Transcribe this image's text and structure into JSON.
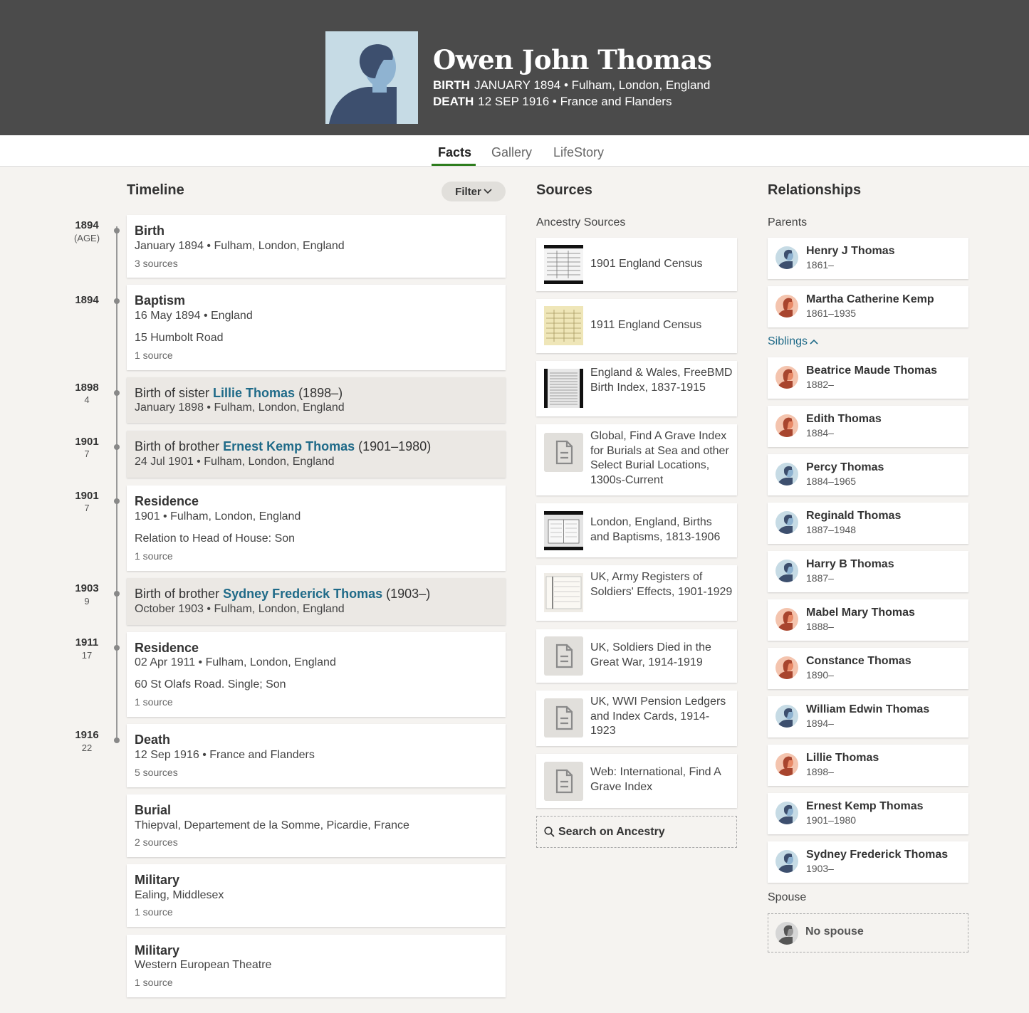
{
  "person": {
    "name": "Owen John Thomas",
    "birth_label": "BIRTH",
    "birth_value": "JANUARY 1894 • Fulham, London, England",
    "death_label": "DEATH",
    "death_value": "12 SEP 1916 • France and Flanders"
  },
  "tabs": [
    {
      "label": "Facts",
      "active": true
    },
    {
      "label": "Gallery",
      "active": false
    },
    {
      "label": "LifeStory",
      "active": false
    }
  ],
  "timeline": {
    "title": "Timeline",
    "filter_label": "Filter",
    "markers": [
      {
        "year": "1894",
        "age": "(AGE)"
      },
      {
        "year": "1894",
        "age": ""
      },
      {
        "year": "1898",
        "age": "4"
      },
      {
        "year": "1901",
        "age": "7"
      },
      {
        "year": "1901",
        "age": "7"
      },
      {
        "year": "1903",
        "age": "9"
      },
      {
        "year": "1911",
        "age": "17"
      },
      {
        "year": "1916",
        "age": "22"
      }
    ],
    "events": [
      {
        "title": "Birth",
        "line1": "January 1894 • Fulham, London, England",
        "sources": "3 sources"
      },
      {
        "title": "Baptism",
        "line1": "16 May 1894 • England",
        "line2": "15 Humbolt Road",
        "sources": "1 source"
      },
      {
        "prefix": "Birth of sister ",
        "link": "Lillie Thomas",
        "suffix": " (1898–)",
        "line1": "January 1898 • Fulham, London, England"
      },
      {
        "prefix": "Birth of brother ",
        "link": "Ernest Kemp Thomas",
        "suffix": " (1901–1980)",
        "line1": "24 Jul 1901 • Fulham, London, England"
      },
      {
        "title": "Residence",
        "line1": "1901 • Fulham, London, England",
        "line2": "Relation to Head of House: Son",
        "sources": "1 source"
      },
      {
        "prefix": "Birth of brother ",
        "link": "Sydney Frederick Thomas",
        "suffix": " (1903–)",
        "line1": "October 1903 • Fulham, London, England"
      },
      {
        "title": "Residence",
        "line1": "02 Apr 1911 • Fulham, London, England",
        "line2": "60 St Olafs Road. Single; Son",
        "sources": "1 source"
      },
      {
        "title": "Death",
        "line1": "12 Sep 1916 • France and Flanders",
        "sources": "5 sources"
      },
      {
        "title": "Burial",
        "line1": "Thiepval, Departement de la Somme, Picardie, France",
        "sources": "2 sources"
      },
      {
        "title": "Military",
        "line1": "Ealing, Middlesex",
        "sources": "1 source"
      },
      {
        "title": "Military",
        "line1": "Western European Theatre",
        "sources": "1 source"
      }
    ]
  },
  "sources": {
    "title": "Sources",
    "subtitle": "Ancestry Sources",
    "items": [
      {
        "name": "1901 England Census",
        "thumb": "census-image"
      },
      {
        "name": "1911 England Census",
        "thumb": "census-image"
      },
      {
        "name": "England & Wales, FreeBMD Birth Index, 1837-1915",
        "thumb": "index-image"
      },
      {
        "name": "Global, Find A Grave Index for Burials at Sea and other Select Burial Locations, 1300s-Current",
        "thumb": "document-icon"
      },
      {
        "name": "London, England, Births and Baptisms, 1813-1906",
        "thumb": "register-image"
      },
      {
        "name": "UK, Army Registers of Soldiers' Effects, 1901-1929",
        "thumb": "register-image"
      },
      {
        "name": "UK, Soldiers Died in the Great War, 1914-1919",
        "thumb": "document-icon"
      },
      {
        "name": "UK, WWI Pension Ledgers and Index Cards, 1914-1923",
        "thumb": "document-icon"
      },
      {
        "name": "Web: International, Find A Grave Index",
        "thumb": "document-icon"
      }
    ],
    "search_label": "Search on Ancestry"
  },
  "relationships": {
    "title": "Relationships",
    "parents_label": "Parents",
    "parents": [
      {
        "name": "Henry J Thomas",
        "dates": "1861–",
        "gender": "male"
      },
      {
        "name": "Martha Catherine Kemp",
        "dates": "1861–1935",
        "gender": "female"
      }
    ],
    "siblings_label": "Siblings",
    "siblings": [
      {
        "name": "Beatrice Maude Thomas",
        "dates": "1882–",
        "gender": "female"
      },
      {
        "name": "Edith Thomas",
        "dates": "1884–",
        "gender": "female"
      },
      {
        "name": "Percy Thomas",
        "dates": "1884–1965",
        "gender": "male"
      },
      {
        "name": "Reginald Thomas",
        "dates": "1887–1948",
        "gender": "male"
      },
      {
        "name": "Harry B Thomas",
        "dates": "1887–",
        "gender": "male"
      },
      {
        "name": "Mabel Mary Thomas",
        "dates": "1888–",
        "gender": "female"
      },
      {
        "name": "Constance Thomas",
        "dates": "1890–",
        "gender": "female"
      },
      {
        "name": "William Edwin Thomas",
        "dates": "1894–",
        "gender": "male"
      },
      {
        "name": "Lillie Thomas",
        "dates": "1898–",
        "gender": "female"
      },
      {
        "name": "Ernest Kemp Thomas",
        "dates": "1901–1980",
        "gender": "male"
      },
      {
        "name": "Sydney Frederick Thomas",
        "dates": "1903–",
        "gender": "male"
      }
    ],
    "spouse_label": "Spouse",
    "no_spouse_label": "No spouse"
  },
  "colors": {
    "header_bg": "#4b4b4b",
    "link": "#1f6a88",
    "tab_accent": "#2e7d1e",
    "male_avatar_bg": "#c6dbe5",
    "female_avatar_bg": "#f4c4ae"
  }
}
